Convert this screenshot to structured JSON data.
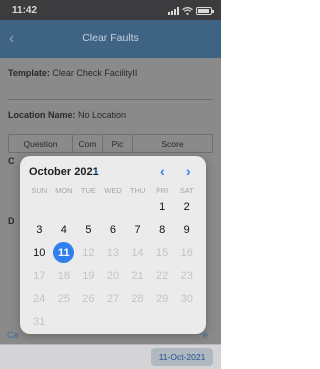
{
  "status_bar": {
    "time": "11:42"
  },
  "nav": {
    "title": "Clear Faults",
    "back_icon": "chevron-left-icon"
  },
  "form": {
    "template_label": "Template:",
    "template_value": "Clear Check FacilityII",
    "location_label": "Location Name:",
    "location_value": "No Location",
    "table_headers": [
      "Question",
      "Com",
      "Pic",
      "Score"
    ],
    "partial_left_1": "C",
    "partial_left_2": "D",
    "partial_cancel": "Ca",
    "partial_right": "e"
  },
  "calendar": {
    "month_label": "October 2021",
    "weekdays": [
      "SUN",
      "MON",
      "TUE",
      "WED",
      "THU",
      "FRI",
      "SAT"
    ],
    "weeks": [
      [
        null,
        null,
        null,
        null,
        null,
        {
          "d": "1",
          "enabled": true
        },
        {
          "d": "2",
          "enabled": true
        }
      ],
      [
        {
          "d": "3",
          "enabled": true
        },
        {
          "d": "4",
          "enabled": true
        },
        {
          "d": "5",
          "enabled": true
        },
        {
          "d": "6",
          "enabled": true
        },
        {
          "d": "7",
          "enabled": true
        },
        {
          "d": "8",
          "enabled": true
        },
        {
          "d": "9",
          "enabled": true
        }
      ],
      [
        {
          "d": "10",
          "enabled": true
        },
        {
          "d": "11",
          "enabled": true,
          "selected": true
        },
        {
          "d": "12",
          "enabled": false
        },
        {
          "d": "13",
          "enabled": false
        },
        {
          "d": "14",
          "enabled": false
        },
        {
          "d": "15",
          "enabled": false
        },
        {
          "d": "16",
          "enabled": false
        }
      ],
      [
        {
          "d": "17",
          "enabled": false
        },
        {
          "d": "18",
          "enabled": false
        },
        {
          "d": "19",
          "enabled": false
        },
        {
          "d": "20",
          "enabled": false
        },
        {
          "d": "21",
          "enabled": false
        },
        {
          "d": "22",
          "enabled": false
        },
        {
          "d": "23",
          "enabled": false
        }
      ],
      [
        {
          "d": "24",
          "enabled": false
        },
        {
          "d": "25",
          "enabled": false
        },
        {
          "d": "26",
          "enabled": false
        },
        {
          "d": "27",
          "enabled": false
        },
        {
          "d": "28",
          "enabled": false
        },
        {
          "d": "29",
          "enabled": false
        },
        {
          "d": "30",
          "enabled": false
        }
      ],
      [
        {
          "d": "31",
          "enabled": false
        },
        null,
        null,
        null,
        null,
        null,
        null
      ]
    ],
    "accent_color": "#2f80ed"
  },
  "bottom_bar": {
    "selected_date": "11-Oct-2021"
  }
}
